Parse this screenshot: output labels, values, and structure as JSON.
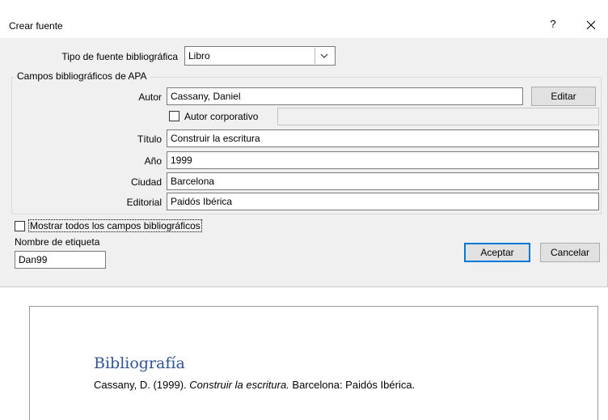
{
  "dialog": {
    "title": "Crear fuente",
    "help_symbol": "?",
    "source_type": {
      "label": "Tipo de fuente bibliográfica",
      "value": "Libro"
    },
    "group_title": "Campos bibliográficos de APA",
    "fields": {
      "author": {
        "label": "Autor",
        "value": "Cassany, Daniel",
        "edit_label": "Editar"
      },
      "corporate_author": {
        "label": "Autor corporativo",
        "checked": false,
        "value": ""
      },
      "title": {
        "label": "Título",
        "value": "Construir la escritura"
      },
      "year": {
        "label": "Año",
        "value": "1999"
      },
      "city": {
        "label": "Ciudad",
        "value": "Barcelona"
      },
      "publisher": {
        "label": "Editorial",
        "value": "Paidós Ibérica"
      }
    },
    "show_all": {
      "label": "Mostrar todos los campos bibliográficos",
      "checked": false
    },
    "tag": {
      "label": "Nombre de etiqueta",
      "value": "Dan99"
    },
    "ok_label": "Aceptar",
    "cancel_label": "Cancelar"
  },
  "document": {
    "heading": "Bibliografía",
    "entry_prefix": "Cassany, D. (1999). ",
    "entry_title": "Construir la escritura.",
    "entry_suffix": " Barcelona: Paidós Ibérica."
  },
  "colors": {
    "heading": "#2f5496",
    "accent_border": "#0078d7",
    "dialog_bg": "#f0f0f0"
  },
  "icons": [
    "close-icon",
    "chevron-down-icon",
    "checkbox-icon"
  ]
}
